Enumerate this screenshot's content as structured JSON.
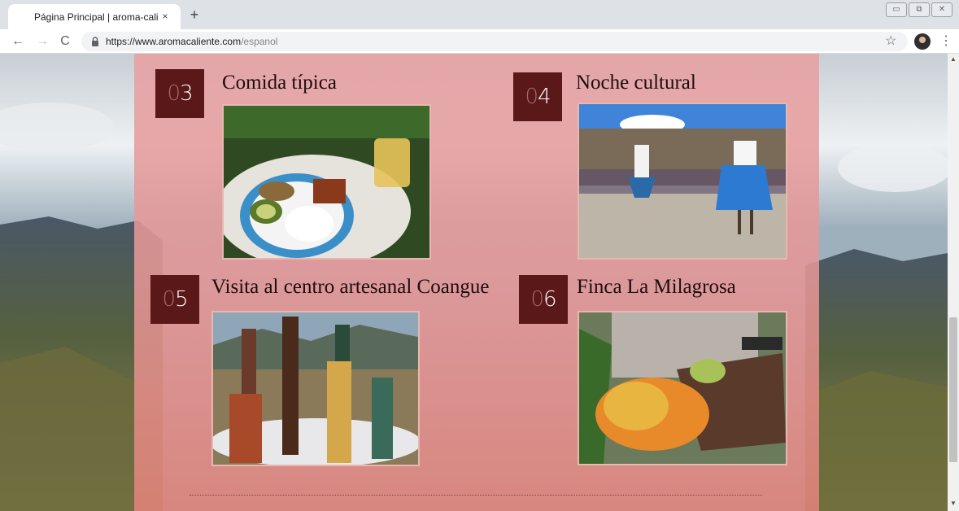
{
  "browser": {
    "tab_title": "Página Principal | aroma-caliente",
    "tab_close": "×",
    "new_tab": "+",
    "url_host": "https://www.aromacaliente.com",
    "url_path": "/espanol",
    "back": "←",
    "forward": "→",
    "reload": "C",
    "star": "☆",
    "menu": "⋮",
    "win_minimize": "▭",
    "win_restore": "⧉",
    "win_close": "✕"
  },
  "items": [
    {
      "zero": "0",
      "num": "3",
      "title": "Comida típica",
      "photo_icon": "food-plate-photo"
    },
    {
      "zero": "0",
      "num": "4",
      "title": "Noche cultural",
      "photo_icon": "dancers-photo"
    },
    {
      "zero": "0",
      "num": "5",
      "title": "Visita al centro artesanal Coangue",
      "photo_icon": "craft-figures-photo"
    },
    {
      "zero": "0",
      "num": "6",
      "title": "Finca La Milagrosa",
      "photo_icon": "fruit-hand-photo"
    }
  ],
  "colors": {
    "panel": "#e8a0a2",
    "number_box": "#5a1818",
    "title_text": "#1d0d0d"
  }
}
